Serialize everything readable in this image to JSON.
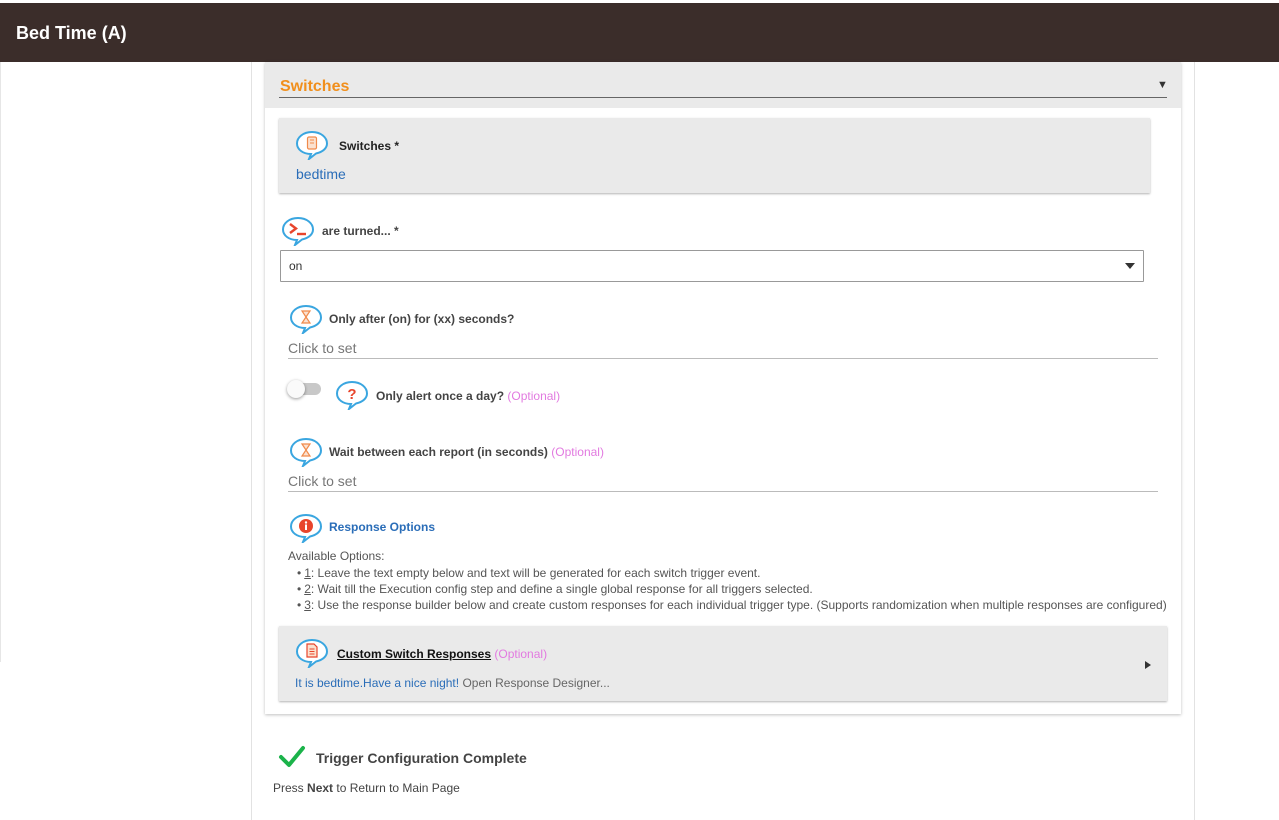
{
  "header": {
    "title": "Bed Time (A)"
  },
  "section": {
    "title": "Switches",
    "collapse_icon": "caret-down-icon"
  },
  "switches_field": {
    "label": "Switches *",
    "value": "bedtime",
    "icon": "device-icon"
  },
  "turned_field": {
    "label": "are turned... *",
    "value": "on",
    "icon": "terminal-icon"
  },
  "only_after_field": {
    "label": "Only after (on) for (xx) seconds?",
    "placeholder": "Click to set",
    "icon": "hourglass-icon"
  },
  "alert_once_field": {
    "label": "Only alert once a day?",
    "optional": "(Optional)",
    "enabled": false,
    "icon": "question-icon"
  },
  "wait_field": {
    "label": "Wait between each report (in seconds)",
    "optional": "(Optional)",
    "placeholder": "Click to set",
    "icon": "hourglass-icon"
  },
  "response_options": {
    "title": "Response Options",
    "icon": "info-icon",
    "available_label": "Available Options:",
    "options": [
      {
        "num": "1",
        "text": ": Leave the text empty below and text will be generated for each switch trigger event."
      },
      {
        "num": "2",
        "text": ": Wait till the Execution config step and define a single global response for all triggers selected."
      },
      {
        "num": "3",
        "text": ": Use the response builder below and create custom responses for each individual trigger type. (Supports randomization when multiple responses are configured)"
      }
    ]
  },
  "custom_responses": {
    "title": "Custom Switch Responses",
    "optional": "(Optional)",
    "response": "It is bedtime.Have a nice night!",
    "designer": "Open Response Designer...",
    "icon": "document-icon"
  },
  "footer": {
    "complete": "Trigger Configuration Complete",
    "press": "Press",
    "next": "Next",
    "rest": "to Return to Main Page",
    "icon": "checkmark-icon"
  },
  "colors": {
    "header_bg": "#3b2d2a",
    "section_accent": "#f18f1c",
    "link_blue": "#2a6db8",
    "optional_pink": "#e27ae0",
    "check_green": "#1bb34a"
  }
}
